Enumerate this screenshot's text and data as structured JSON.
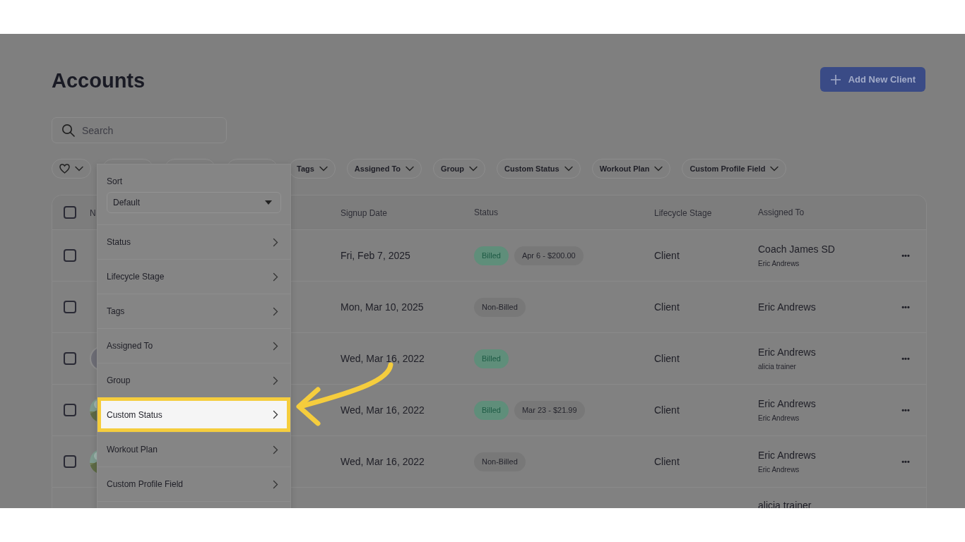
{
  "page": {
    "title": "Accounts"
  },
  "add_button": {
    "label": "Add New Client"
  },
  "search": {
    "placeholder": "Search"
  },
  "filters": [
    {
      "kind": "favorites"
    },
    {
      "kind": "covered"
    },
    {
      "kind": "covered"
    },
    {
      "kind": "covered"
    },
    {
      "kind": "text",
      "label": "Tags"
    },
    {
      "kind": "text",
      "label": "Assigned To"
    },
    {
      "kind": "text",
      "label": "Group"
    },
    {
      "kind": "text",
      "label": "Custom Status"
    },
    {
      "kind": "text",
      "label": "Workout Plan"
    },
    {
      "kind": "text",
      "label": "Custom Profile Field"
    }
  ],
  "table": {
    "select_all_checked": false,
    "columns": [
      "N",
      "Signup Date",
      "Status",
      "Lifecycle Stage",
      "Assigned To"
    ],
    "rows": [
      {
        "checked": false,
        "more": "•••",
        "signup": "Fri, Feb 7, 2025",
        "badges": [
          {
            "text": "Billed",
            "kind": "billed"
          },
          {
            "text": "Apr 6 - $200.00",
            "kind": "plain"
          }
        ],
        "stage": "Client",
        "assigned": "Coach James SD",
        "assigned_sub": "Eric Andrews"
      },
      {
        "checked": false,
        "more": "•••",
        "signup": "Mon, Mar 10, 2025",
        "badges": [
          {
            "text": "Non-Billed",
            "kind": "plain"
          }
        ],
        "stage": "Client",
        "assigned": "Eric Andrews"
      },
      {
        "checked": false,
        "more": "•••",
        "avatar": {
          "kind": "plain"
        },
        "signup": "Wed, Mar 16, 2022",
        "badges": [
          {
            "text": "Billed",
            "kind": "billed"
          }
        ],
        "stage": "Client",
        "assigned": "Eric Andrews",
        "assigned_sub": "alicia trainer"
      },
      {
        "checked": false,
        "more": "•••",
        "avatar": {
          "kind": "picture"
        },
        "signup": "Wed, Mar 16, 2022",
        "badges": [
          {
            "text": "Billed",
            "kind": "billed"
          },
          {
            "text": "Mar 23 - $21.99",
            "kind": "plain"
          }
        ],
        "stage": "Client",
        "assigned": "Eric Andrews",
        "assigned_sub": "Eric Andrews"
      },
      {
        "checked": false,
        "more": "•••",
        "avatar": {
          "kind": "picture"
        },
        "signup": "Wed, Mar 16, 2022",
        "badges": [
          {
            "text": "Non-Billed",
            "kind": "plain"
          }
        ],
        "stage": "Client",
        "assigned": "Eric Andrews",
        "assigned_sub": "Eric Andrews"
      },
      {
        "assigned": "alicia trainer"
      }
    ]
  },
  "menu": {
    "sort_label": "Sort",
    "sort_value": "Default",
    "items": [
      {
        "label": "Status",
        "selected": false
      },
      {
        "label": "Lifecycle Stage",
        "selected": false
      },
      {
        "label": "Tags",
        "selected": false
      },
      {
        "label": "Assigned To",
        "selected": false
      },
      {
        "label": "Group",
        "selected": false
      },
      {
        "label": "Custom Status",
        "selected": true
      },
      {
        "label": "Workout Plan",
        "selected": false
      },
      {
        "label": "Custom Profile Field",
        "selected": false
      }
    ]
  }
}
